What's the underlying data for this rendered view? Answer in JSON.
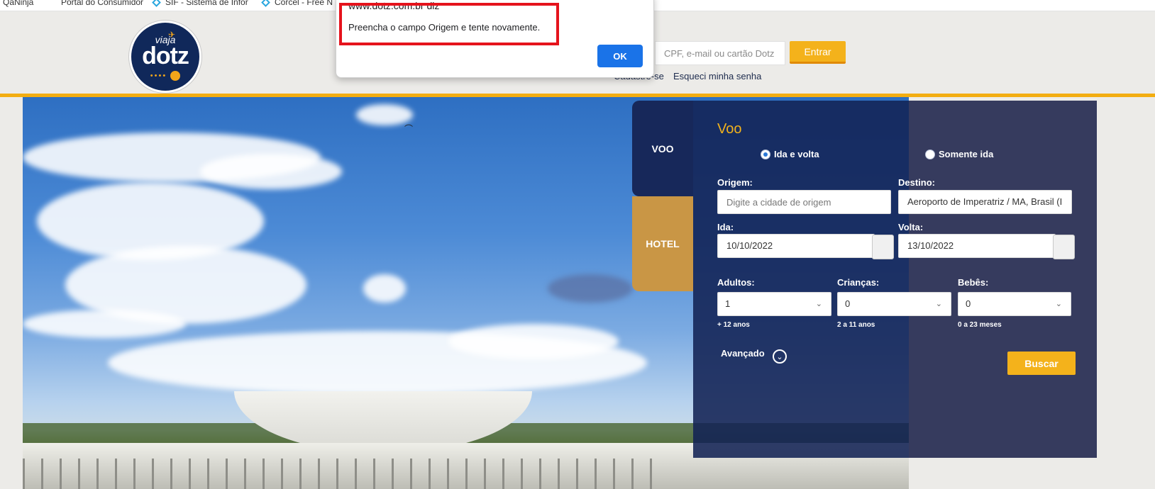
{
  "bookmarks": [
    {
      "label": "QaNinja",
      "icon": "bookmark-icon"
    },
    {
      "label": "Portal do Consumidor",
      "icon": "bookmark-icon"
    },
    {
      "label": "SIF - Sistema de Infor",
      "icon": "diamond-icon"
    },
    {
      "label": "Corcel - Free N",
      "icon": "diamond-icon"
    }
  ],
  "logo": {
    "small": "viaja",
    "main": "dotz",
    "dots": "••••"
  },
  "login": {
    "placeholder": "CPF, e-mail ou cartão Dotz",
    "submit_label": "Entrar",
    "register_link": "Cadastre-se",
    "forgot_link": "Esqueci minha senha"
  },
  "dialog": {
    "origin": "www.dotz.com.br diz",
    "message": "Preencha o campo Origem e tente novamente.",
    "ok_label": "OK"
  },
  "tabs": {
    "voo": "VOO",
    "hotel": "HOTEL"
  },
  "form": {
    "title": "Voo",
    "trip_types": [
      {
        "label": "Ida e volta",
        "selected": true
      },
      {
        "label": "Somente ida",
        "selected": false
      }
    ],
    "origin": {
      "label": "Origem:",
      "placeholder": "Digite a cidade de origem",
      "value": ""
    },
    "destination": {
      "label": "Destino:",
      "value": "Aeroporto de Imperatriz / MA, Brasil (I"
    },
    "departure": {
      "label": "Ida:",
      "value": "10/10/2022"
    },
    "return": {
      "label": "Volta:",
      "value": "13/10/2022"
    },
    "adults": {
      "label": "Adultos:",
      "value": "1",
      "hint": "+ 12 anos"
    },
    "children": {
      "label": "Crianças:",
      "value": "0",
      "hint": "2 a 11 anos"
    },
    "infants": {
      "label": "Bebês:",
      "value": "0",
      "hint": "0 a 23 meses"
    },
    "advanced_label": "Avançado",
    "search_label": "Buscar"
  },
  "colors": {
    "accent": "#f4b21b",
    "navy": "#17285a",
    "hotel_tab": "#c99645",
    "dialog_button": "#1a73e8",
    "highlight": "#e5131c"
  }
}
